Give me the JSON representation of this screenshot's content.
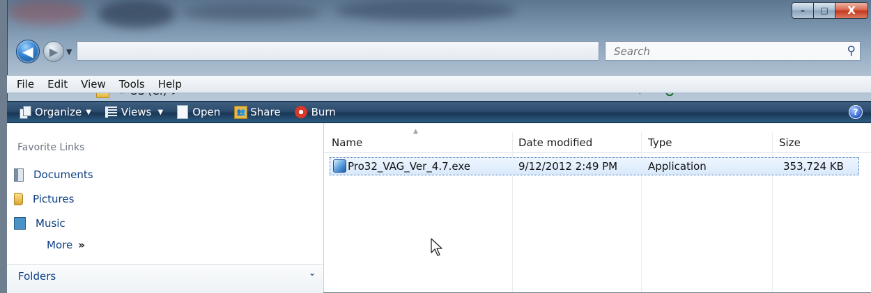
{
  "window": {
    "controls": {
      "minimize": "–",
      "maximize": "□",
      "close": "X"
    }
  },
  "nav": {
    "back_glyph": "◀",
    "forward_glyph": "▶",
    "address_chevron": "«",
    "address_location": "OS (C:)",
    "address_arrow": "▸",
    "refresh_glyph": "⁺↻",
    "search_placeholder": "Search"
  },
  "menu": {
    "items": [
      "File",
      "Edit",
      "View",
      "Tools",
      "Help"
    ]
  },
  "toolbar": {
    "organize": "Organize",
    "views": "Views",
    "open": "Open",
    "share": "Share",
    "burn": "Burn",
    "help": "?"
  },
  "favorites": {
    "title": "Favorite Links",
    "items": [
      "Documents",
      "Pictures",
      "Music"
    ],
    "more": "More",
    "more_glyph": "»"
  },
  "folders": {
    "label": "Folders",
    "chevron": "⌄"
  },
  "filelist": {
    "columns": [
      "Name",
      "Date modified",
      "Type",
      "Size"
    ],
    "rows": [
      {
        "name": "Pro32_VAG_Ver_4.7.exe",
        "date_modified": "9/12/2012 2:49 PM",
        "type": "Application",
        "size": "353,724 KB"
      }
    ]
  },
  "colors": {
    "link_blue": "#0c3e83",
    "toolbar_dark": "#1a3756",
    "selection_border": "#3c6fb3"
  }
}
